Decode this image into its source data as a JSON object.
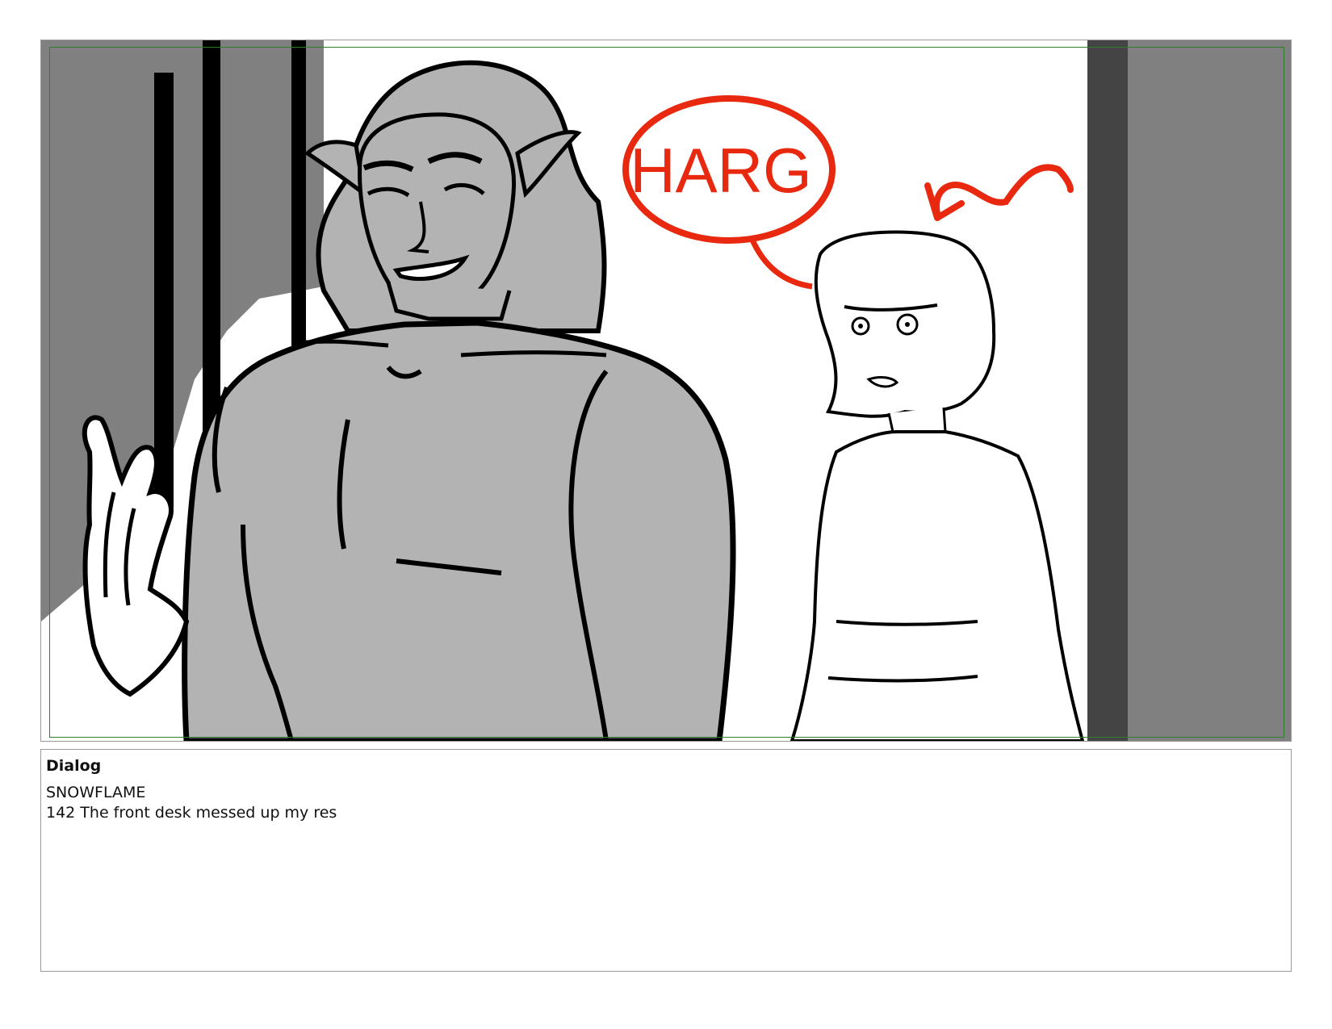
{
  "panel": {
    "speech_bubble_text": "HARG",
    "colors": {
      "ink": "#000000",
      "gray_fill": "#b3b3b3",
      "dark_gray": "#444444",
      "mid_gray": "#808080",
      "red_ink": "#e8280f",
      "safe_area": "#2f7d2f"
    }
  },
  "dialog": {
    "label": "Dialog",
    "speaker": "SNOWFLAME",
    "line": "142 The front desk messed up my res"
  }
}
